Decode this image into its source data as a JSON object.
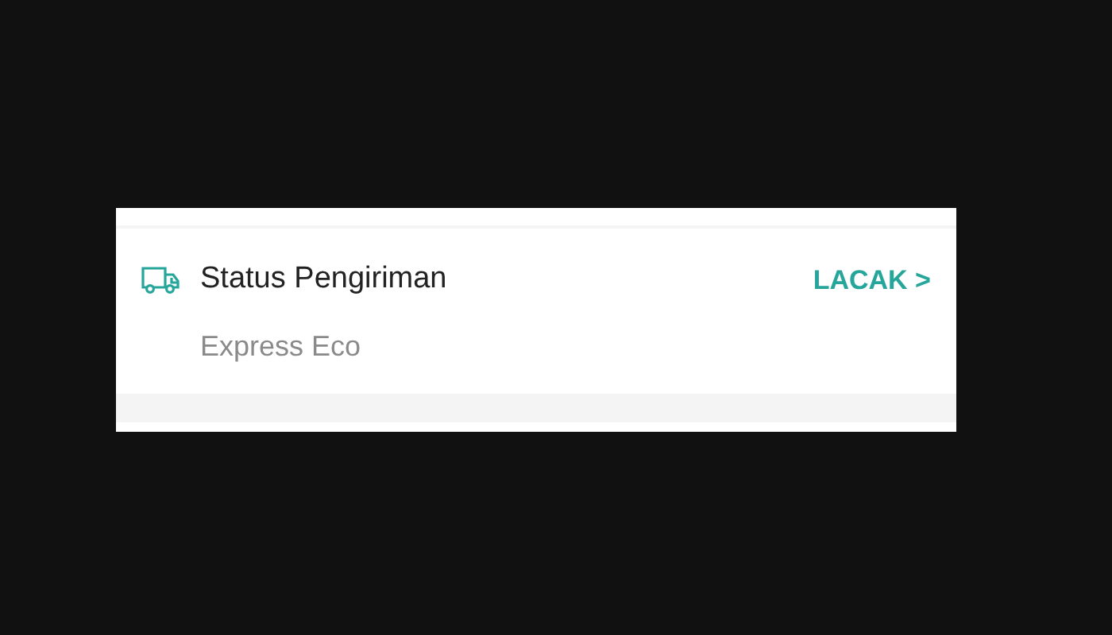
{
  "shipping_status": {
    "title": "Status Pengiriman",
    "courier": "Express Eco",
    "track_link": "LACAK >"
  }
}
